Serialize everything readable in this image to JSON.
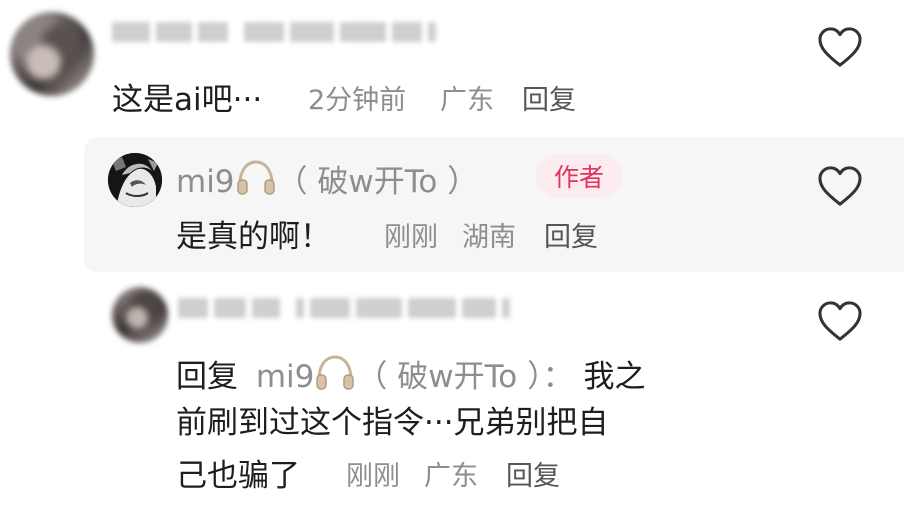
{
  "comment1": {
    "username": "",
    "text": "这是ai吧···",
    "time": "2分钟前",
    "location": "广东",
    "reply_label": "回复"
  },
  "reply1": {
    "username_prefix": "mi9",
    "username_suffix": "（ 破w开To ）",
    "author_badge": "作者",
    "text": "是真的啊！",
    "time": "刚刚",
    "location": "湖南",
    "reply_label": "回复"
  },
  "reply2": {
    "reply_word": "回复",
    "target_prefix": "mi9",
    "target_suffix": "（ 破w开To ）：",
    "text_line1_part": "我之",
    "text_line2": "前刷到过这个指令···兄弟别把自",
    "text_line3": "己也骗了",
    "time": "刚刚",
    "location": "广东",
    "reply_label": "回复"
  },
  "icons": {
    "like": "heart-outline-icon",
    "headphones": "headphones-icon"
  },
  "colors": {
    "author_badge_text": "#e0345d",
    "author_badge_bg": "#fdecef",
    "meta_gray": "#8e8e8e",
    "reply_bg": "#f6f6f6"
  }
}
